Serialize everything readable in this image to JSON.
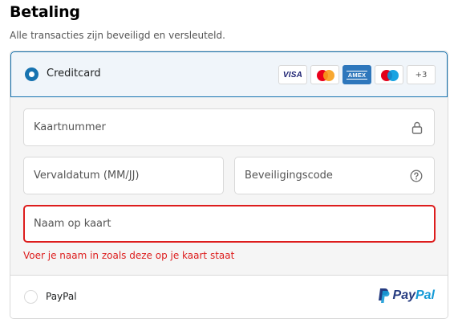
{
  "header": {
    "title": "Betaling",
    "subtitle": "Alle transacties zijn beveiligd en versleuteld."
  },
  "creditcard_option": {
    "label": "Creditcard",
    "selected": true,
    "brands": {
      "visa": "VISA",
      "mastercard_icon": "mastercard-logo",
      "amex": "AMEX",
      "maestro_icon": "maestro-logo",
      "more": "+3"
    }
  },
  "form": {
    "card_number": {
      "placeholder": "Kaartnummer",
      "value": "",
      "icon": "lock-icon"
    },
    "expiry": {
      "placeholder": "Vervaldatum (MM/JJ)",
      "value": ""
    },
    "security_code": {
      "placeholder": "Beveiligingscode",
      "value": "",
      "icon": "help-icon"
    },
    "name_on_card": {
      "placeholder": "Naam op kaart",
      "value": ""
    },
    "name_error": "Voer je naam in zoals deze op je kaart staat"
  },
  "paypal_option": {
    "label": "PayPal",
    "selected": false,
    "logo_text_1": "Pay",
    "logo_text_2": "Pal"
  },
  "colors": {
    "accent": "#1773b0",
    "error": "#dd1d1d",
    "selected_background": "#f0f5fa",
    "form_background": "#f5f5f5"
  }
}
